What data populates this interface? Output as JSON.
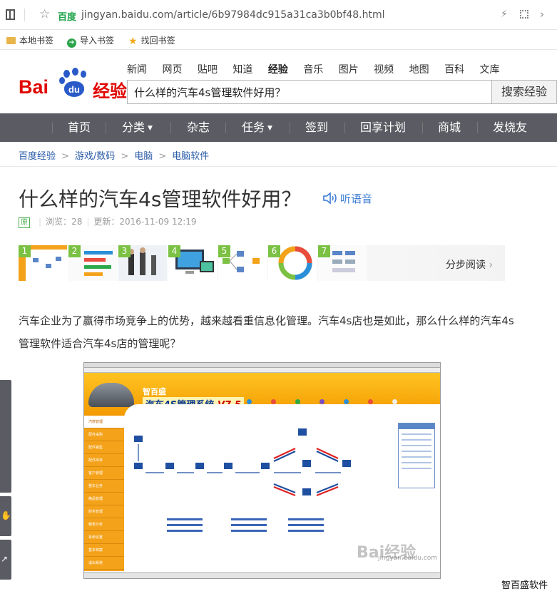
{
  "browser": {
    "shield_text": "百度",
    "url": "jingyan.baidu.com/article/6b97984dc915a31ca3b0bf48.html"
  },
  "bookmarks": [
    {
      "label": "本地书签",
      "icon": "folder-icon"
    },
    {
      "label": "导入书签",
      "icon": "import-icon"
    },
    {
      "label": "找回书签",
      "icon": "star-icon"
    }
  ],
  "logo": {
    "bai": "Bai",
    "du": "du",
    "jingyan": "经验"
  },
  "top_nav": [
    "新闻",
    "网页",
    "贴吧",
    "知道",
    "经验",
    "音乐",
    "图片",
    "视频",
    "地图",
    "百科",
    "文库"
  ],
  "top_nav_active": "经验",
  "search": {
    "value": "什么样的汽车4s管理软件好用？",
    "button": "搜索经验"
  },
  "main_nav": [
    "首页",
    "分类",
    "杂志",
    "任务",
    "签到",
    "回享计划",
    "商城",
    "发烧友"
  ],
  "breadcrumb": [
    "百度经验",
    "游戏/数码",
    "电脑",
    "电脑软件"
  ],
  "article": {
    "title": "什么样的汽车4s管理软件好用？",
    "listen": "听语音",
    "original_badge": "原",
    "views_label": "浏览：",
    "views": "28",
    "updated_label": "更新：",
    "updated": "2016-11-09 12:19",
    "step_numbers": [
      "1",
      "2",
      "3",
      "4",
      "5",
      "6",
      "7"
    ],
    "step_read": "分步阅读",
    "paragraph": "汽车企业为了赢得市场竞争上的优势，越来越看重信息化管理。汽车4s店也是如此，那么什么样的汽车4s管理软件适合汽车4s店的管理呢？",
    "image_caption": "智百盛软件"
  },
  "screenshot": {
    "brand": "智百盛",
    "product": "汽车4S管理系统",
    "version": "V7.5",
    "watermark": "Bai经验",
    "watermark_sub": "jingyan.baidu.com",
    "menu": [
      "汽修管理",
      "配件采购",
      "配件销售",
      "配件库存",
      "客户管理",
      "整车业务",
      "精品管理",
      "财务管理",
      "報表分析",
      "系统设置",
      "基本档案",
      "退出系统"
    ]
  },
  "colors": {
    "nav_bg": "#5b5c63",
    "link": "#2b5ca8",
    "brand_red": "#e10601",
    "brand_blue": "#2a5ac8",
    "step_green": "#7bc143"
  }
}
